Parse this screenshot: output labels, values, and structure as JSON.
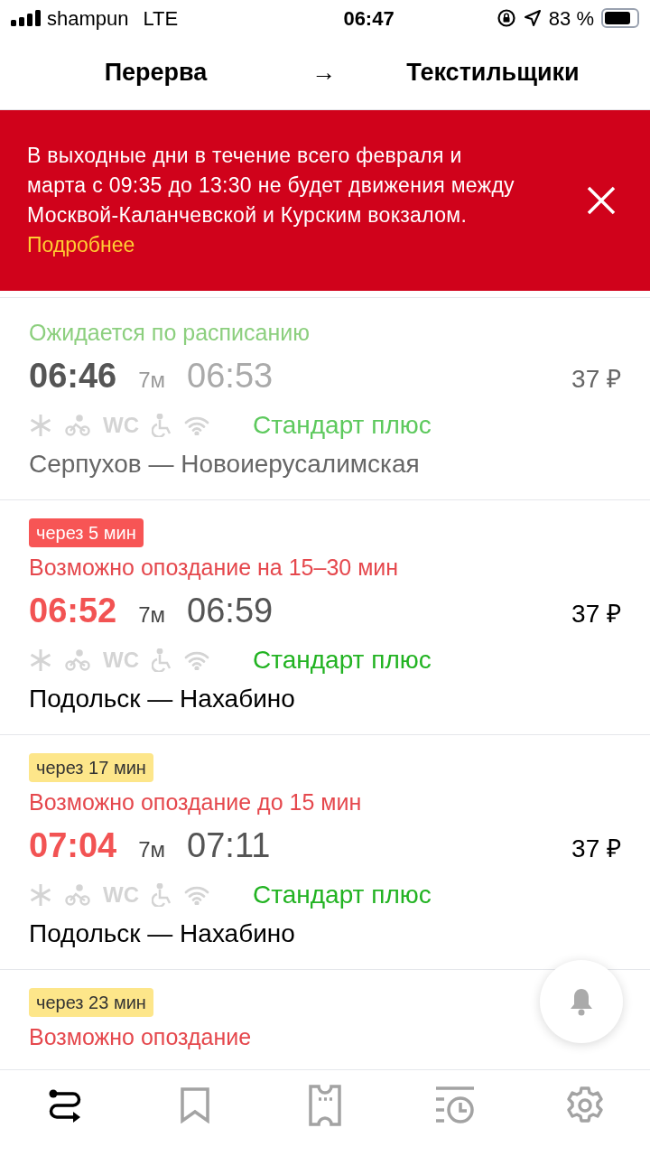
{
  "status_bar": {
    "carrier": "shampun",
    "network": "LTE",
    "time": "06:47",
    "battery": "83 %"
  },
  "header": {
    "from": "Перерва",
    "arrow": "→",
    "to": "Текстильщики"
  },
  "alert": {
    "text": "В выходные дни в течение всего февраля и марта с 09:35 до 13:30 не будет движения между Москвой-Каланчевской и Курским вокзалом.",
    "link": "Подробнее"
  },
  "trains": [
    {
      "kind": "departed",
      "status": "Ожидается по расписанию",
      "delayed": false,
      "departure": "06:46",
      "duration": "7м",
      "arrival": "06:53",
      "price": "37 ₽",
      "wc_label": "WC",
      "tariff": "Стандарт плюс",
      "route": "Серпухов — Новоиерусалимская"
    },
    {
      "kind": "upcoming",
      "badge": {
        "text": "через 5 мин",
        "color": "#f75555"
      },
      "status": "Возможно опоздание на 15–30 мин",
      "delayed": true,
      "departure": "06:52",
      "duration": "7м",
      "arrival": "06:59",
      "price": "37 ₽",
      "wc_label": "WC",
      "tariff": "Стандарт плюс",
      "route": "Подольск — Нахабино"
    },
    {
      "kind": "upcoming",
      "badge": {
        "text": "через 17 мин",
        "color": "#fde68a"
      },
      "status": "Возможно опоздание до 15 мин",
      "delayed": true,
      "departure": "07:04",
      "duration": "7м",
      "arrival": "07:11",
      "price": "37 ₽",
      "wc_label": "WC",
      "tariff": "Стандарт плюс",
      "route": "Подольск — Нахабино"
    },
    {
      "kind": "upcoming",
      "badge": {
        "text": "через 23 мин",
        "color": "#fde68a"
      },
      "status": "Возможно опоздание",
      "delayed": true
    }
  ],
  "tabs": [
    {
      "kind": "route",
      "selected": true
    },
    {
      "kind": "bookmark",
      "selected": false
    },
    {
      "kind": "ticket",
      "selected": false
    },
    {
      "kind": "history",
      "selected": false
    },
    {
      "kind": "settings",
      "selected": false
    }
  ]
}
